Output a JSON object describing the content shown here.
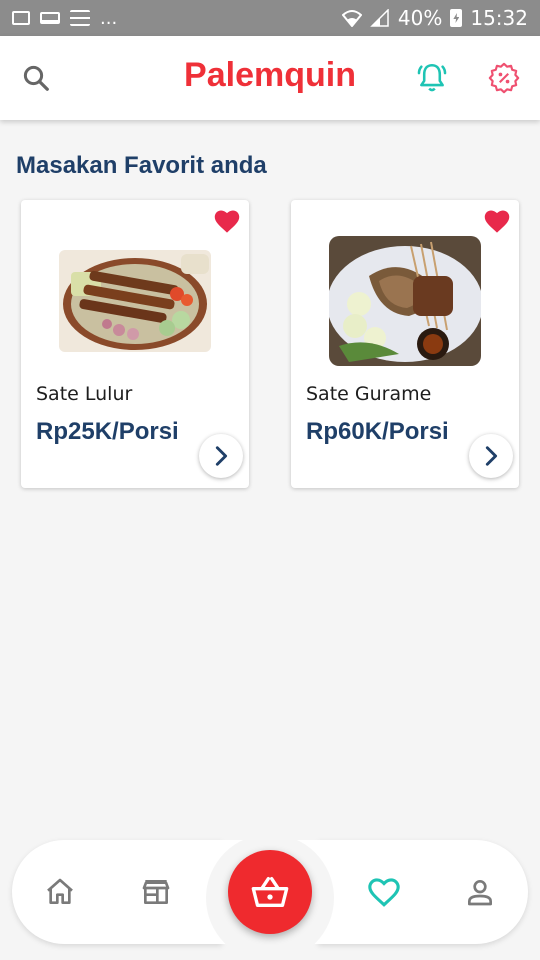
{
  "status_bar": {
    "dots": "...",
    "battery_percent": "40%",
    "time": "15:32"
  },
  "app_bar": {
    "title": "Palemquin",
    "title_color": "#ef3038",
    "icons": [
      "search-icon",
      "bell-icon",
      "discount-icon"
    ]
  },
  "favorites": {
    "section_title": "Masakan Favorit anda",
    "items": [
      {
        "name": "Sate Lulur",
        "price": "Rp25K/Porsi",
        "favorited": true
      },
      {
        "name": "Sate Gurame",
        "price": "Rp60K/Porsi",
        "favorited": true
      }
    ]
  },
  "bottom_nav": {
    "items": [
      "home-icon",
      "store-icon",
      "basket-icon",
      "heart-icon",
      "profile-icon"
    ],
    "active": "heart-icon",
    "active_color": "#1ec4b4",
    "fab_color": "#ef2a2e"
  }
}
